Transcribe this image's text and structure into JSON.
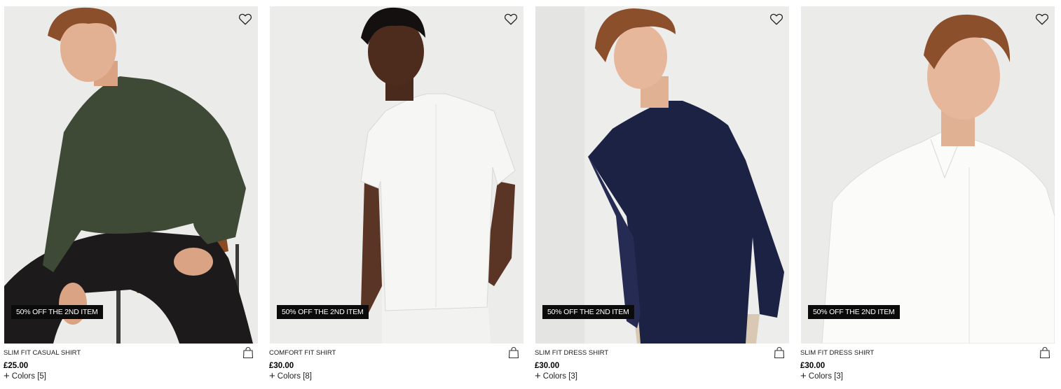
{
  "products": [
    {
      "name": "SLIM FIT CASUAL SHIRT",
      "price": "£25.00",
      "colors_label": "Colors [5]",
      "promo": "50% OFF THE 2ND ITEM",
      "shirt_color": "#3e4a36",
      "trouser_color": "#1c1a1a",
      "bg_color": "#ebebea"
    },
    {
      "name": "COMFORT FIT SHIRT",
      "price": "£30.00",
      "colors_label": "Colors [8]",
      "promo": "50% OFF THE 2ND ITEM",
      "shirt_color": "#f6f6f4",
      "trouser_color": "#f2f2f0",
      "bg_color": "#ececea"
    },
    {
      "name": "SLIM FIT DRESS SHIRT",
      "price": "£30.00",
      "colors_label": "Colors [3]",
      "promo": "50% OFF THE 2ND ITEM",
      "shirt_color": "#1c2244",
      "trouser_color": "#d9c9b4",
      "bg_color": "#ededeb"
    },
    {
      "name": "SLIM FIT DRESS SHIRT",
      "price": "£30.00",
      "colors_label": "Colors [3]",
      "promo": "50% OFF THE 2ND ITEM",
      "shirt_color": "#fbfbfa",
      "trouser_color": "#fbfbfa",
      "bg_color": "#ebebea"
    }
  ],
  "icons": {
    "wishlist": "heart-icon",
    "bag": "shopping-bag-icon",
    "expand": "plus-icon"
  }
}
